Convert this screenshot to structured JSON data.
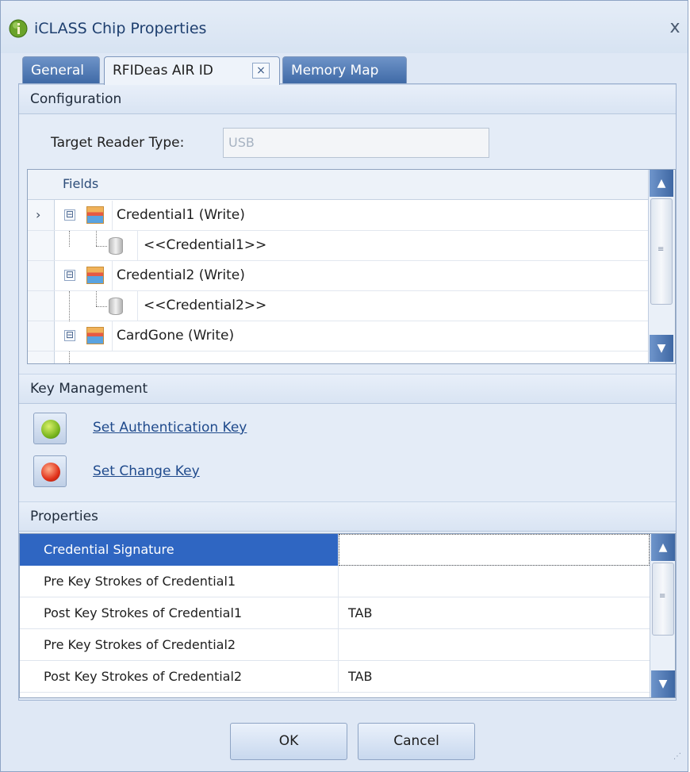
{
  "window": {
    "title": "iCLASS Chip Properties",
    "close_glyph": "x",
    "icon": "info-leaf-icon"
  },
  "tabs": [
    {
      "label": "General",
      "active": false
    },
    {
      "label": "RFIDeas AIR ID",
      "active": true,
      "close_glyph": "×"
    },
    {
      "label": "Memory Map",
      "active": false
    }
  ],
  "configuration": {
    "header": "Configuration",
    "target_reader_label": "Target Reader Type:",
    "target_reader_value": "USB",
    "fields": {
      "header": "Fields",
      "rows": [
        {
          "label": "Credential1 (Write)",
          "kind": "credential",
          "expander": "⊟",
          "selected": true
        },
        {
          "label": "<<Credential1>>",
          "kind": "db"
        },
        {
          "label": "Credential2 (Write)",
          "kind": "credential",
          "expander": "⊟"
        },
        {
          "label": "<<Credential2>>",
          "kind": "db"
        },
        {
          "label": "CardGone (Write)",
          "kind": "credential",
          "expander": "⊟"
        }
      ],
      "row_arrow": "›"
    }
  },
  "key_management": {
    "header": "Key Management",
    "auth_link": "Set Authentication Key",
    "change_link": "Set Change Key"
  },
  "properties": {
    "header": "Properties",
    "rows": [
      {
        "name": "Credential Signature",
        "value": "",
        "selected": true
      },
      {
        "name": "Pre Key Strokes of Credential1",
        "value": ""
      },
      {
        "name": "Post Key Strokes of Credential1",
        "value": "TAB"
      },
      {
        "name": "Pre Key Strokes of Credential2",
        "value": ""
      },
      {
        "name": "Post Key Strokes of Credential2",
        "value": "TAB"
      }
    ]
  },
  "buttons": {
    "ok": "OK",
    "cancel": "Cancel"
  },
  "scroll": {
    "up_glyph": "▲",
    "down_glyph": "▼"
  },
  "colors": {
    "accent": "#2f66c2",
    "tab_inactive": "#4f78b4",
    "link": "#1f4a8c"
  }
}
